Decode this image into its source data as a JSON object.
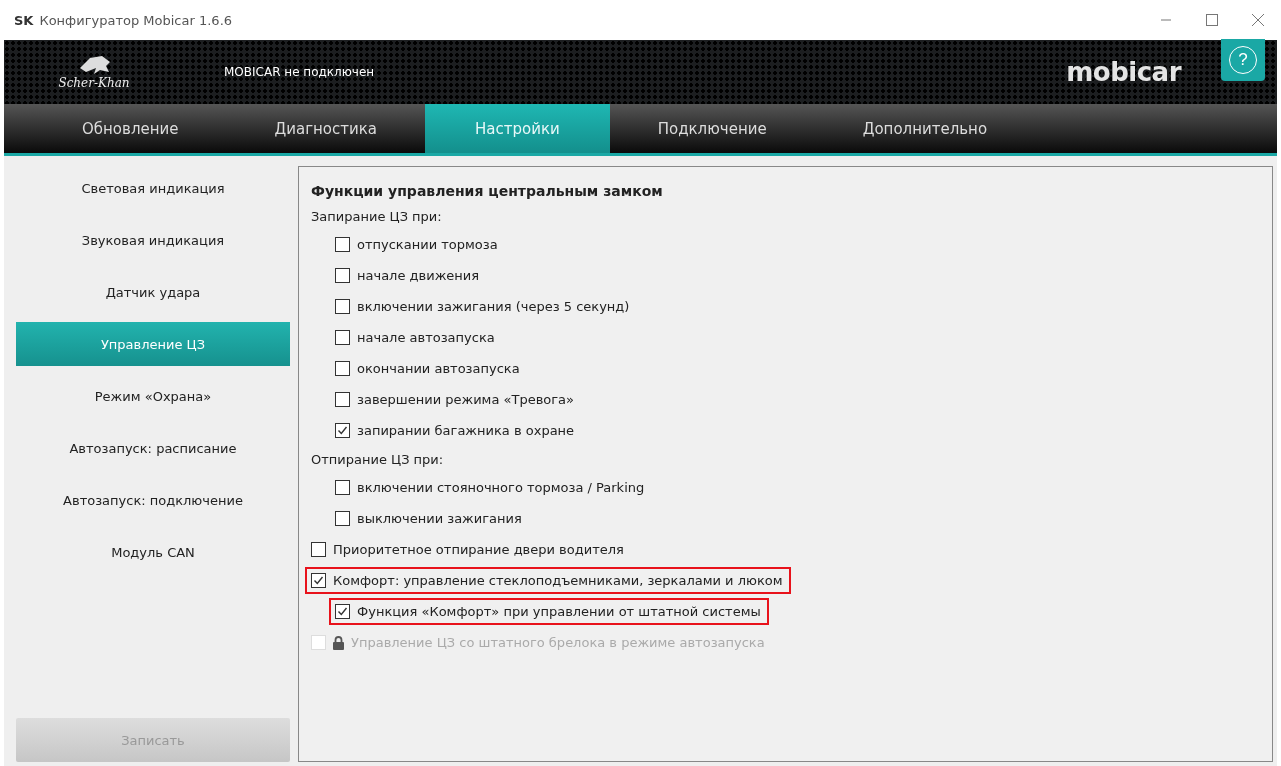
{
  "window": {
    "badge": "SK",
    "title": "Конфигуратор Mobicar 1.6.6"
  },
  "header": {
    "brand": "Scher-Khan",
    "status": "MOBICAR не подключен",
    "logo": "mobicar",
    "help": "?"
  },
  "tabs": [
    {
      "label": "Обновление",
      "selected": false
    },
    {
      "label": "Диагностика",
      "selected": false
    },
    {
      "label": "Настройки",
      "selected": true
    },
    {
      "label": "Подключение",
      "selected": false
    },
    {
      "label": "Дополнительно",
      "selected": false
    }
  ],
  "sidebar": {
    "items": [
      {
        "label": "Световая индикация",
        "selected": false
      },
      {
        "label": "Звуковая индикация",
        "selected": false
      },
      {
        "label": "Датчик удара",
        "selected": false
      },
      {
        "label": "Управление ЦЗ",
        "selected": true
      },
      {
        "label": "Режим «Охрана»",
        "selected": false
      },
      {
        "label": "Автозапуск: расписание",
        "selected": false
      },
      {
        "label": "Автозапуск: подключение",
        "selected": false
      },
      {
        "label": "Модуль CAN",
        "selected": false
      }
    ],
    "write_button": {
      "label": "Записать",
      "disabled": true
    }
  },
  "panel": {
    "title": "Функции управления центральным замком",
    "groups": [
      {
        "label": "Запирание ЦЗ при:",
        "options": [
          {
            "label": "отпускании тормоза",
            "checked": false
          },
          {
            "label": "начале движения",
            "checked": false
          },
          {
            "label": "включении зажигания (через 5 секунд)",
            "checked": false
          },
          {
            "label": "начале автозапуска",
            "checked": false
          },
          {
            "label": "окончании автозапуска",
            "checked": false
          },
          {
            "label": "завершении режима «Тревога»",
            "checked": false
          },
          {
            "label": "запирании багажника в охране",
            "checked": true
          }
        ]
      },
      {
        "label": "Отпирание ЦЗ при:",
        "options": [
          {
            "label": "включении стояночного тормоза / Parking",
            "checked": false
          },
          {
            "label": "выключении зажигания",
            "checked": false
          }
        ]
      }
    ],
    "options": [
      {
        "label": "Приоритетное отпирание двери водителя",
        "checked": false,
        "highlighted": false,
        "disabled": false,
        "locked": false
      },
      {
        "label": "Комфорт: управление стеклоподъемниками, зеркалами и люком",
        "checked": true,
        "highlighted": true,
        "disabled": false,
        "locked": false,
        "children": [
          {
            "label": "Функция «Комфорт» при управлении от штатной системы",
            "checked": true,
            "highlighted": true,
            "disabled": false,
            "locked": false
          }
        ]
      },
      {
        "label": "Управление ЦЗ со штатного брелока в режиме автозапуска",
        "checked": false,
        "highlighted": false,
        "disabled": true,
        "locked": true
      }
    ]
  }
}
